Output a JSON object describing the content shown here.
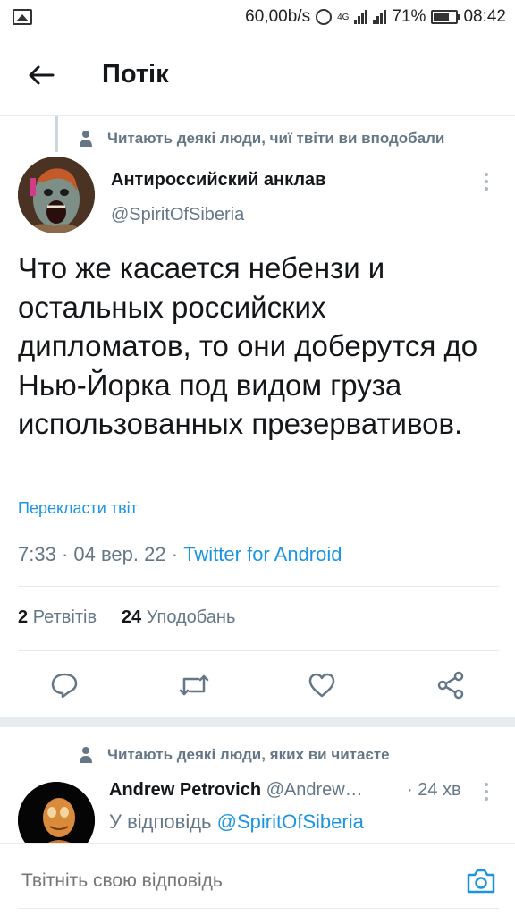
{
  "status_bar": {
    "net_speed": "60,00b/s",
    "network": "4G",
    "battery": "71%",
    "battery_level": 0.71,
    "time": "08:42"
  },
  "header": {
    "title": "Потік",
    "back_icon": "arrow-left-icon"
  },
  "main_tweet": {
    "context": "Читають деякі люди, чиї твіти ви вподобали",
    "author_name": "Антироссийский анклав",
    "author_handle": "@SpiritOfSiberia",
    "text": "Что же касается небензи и остальных российских дипломатов, то они доберутся до Нью-Йорка под видом груза использованных презервативов.",
    "translate": "Перекласти твіт",
    "time": "7:33",
    "date": "04 вер. 22",
    "source": "Twitter for Android",
    "retweets_count": "2",
    "retweets_label": "Ретвітів",
    "likes_count": "24",
    "likes_label": "Уподобань"
  },
  "reply_tweet": {
    "context": "Читають деякі люди, яких ви читаєте",
    "author_name": "Andrew Petrovich",
    "author_handle": "@Andrew…",
    "time": "24 хв",
    "reply_prefix": "У відповідь",
    "reply_mention": "@SpiritOfSiberia"
  },
  "compose": {
    "placeholder": "Твітніть свою відповідь",
    "camera_icon": "camera-icon"
  },
  "colors": {
    "accent": "#1b95e0",
    "secondary_text": "#657786",
    "divider": "#e6ecf0"
  }
}
